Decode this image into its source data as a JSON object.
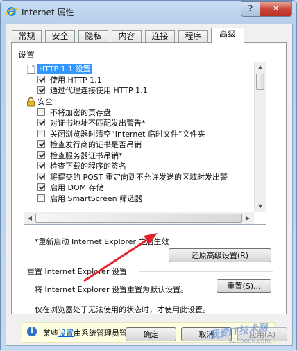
{
  "window": {
    "title": "Internet 属性",
    "help_label": "?",
    "close_label": "✕"
  },
  "tabs": [
    {
      "label": "常规",
      "active": false
    },
    {
      "label": "安全",
      "active": false
    },
    {
      "label": "隐私",
      "active": false
    },
    {
      "label": "内容",
      "active": false
    },
    {
      "label": "连接",
      "active": false
    },
    {
      "label": "程序",
      "active": false
    },
    {
      "label": "高级",
      "active": true
    }
  ],
  "settings": {
    "group_label": "设置",
    "items": [
      {
        "kind": "category",
        "icon": "page-icon",
        "text": "HTTP 1.1 设置",
        "selected": true
      },
      {
        "kind": "checkbox",
        "checked": true,
        "text": "使用 HTTP 1.1"
      },
      {
        "kind": "checkbox",
        "checked": true,
        "text": "通过代理连接使用 HTTP 1.1"
      },
      {
        "kind": "category",
        "icon": "lock-icon",
        "text": "安全",
        "selected": false
      },
      {
        "kind": "checkbox",
        "checked": false,
        "text": "不将加密的页存盘"
      },
      {
        "kind": "checkbox",
        "checked": true,
        "text": "对证书地址不匹配发出警告*"
      },
      {
        "kind": "checkbox",
        "checked": false,
        "text": "关闭浏览器时清空“Internet 临时文件”文件夹"
      },
      {
        "kind": "checkbox",
        "checked": true,
        "text": "检查发行商的证书是否吊销"
      },
      {
        "kind": "checkbox",
        "checked": true,
        "text": "检查服务器证书吊销*"
      },
      {
        "kind": "checkbox",
        "checked": true,
        "text": "检查下载的程序的签名"
      },
      {
        "kind": "checkbox",
        "checked": true,
        "text": "将提交的 POST 重定向到不允许发送的区域时发出警"
      },
      {
        "kind": "checkbox",
        "checked": true,
        "text": "启用 DOM 存储"
      },
      {
        "kind": "checkbox",
        "checked": false,
        "text": "启用 SmartScreen 筛选器"
      }
    ],
    "restart_note": "*重新启动 Internet Explorer 之后生效",
    "restore_button": "还原高级设置(R)"
  },
  "reset": {
    "title": "重置 Internet Explorer 设置",
    "description": "将 Internet Explorer 设置重置为默认设置。",
    "button": "重置(S)...",
    "note": "仅在浏览器处于无法使用的状态时，才使用此设置。"
  },
  "info": {
    "icon": "info-icon",
    "text_before": "某些",
    "link": "设置",
    "text_after": "由系统管理员管理。"
  },
  "footer": {
    "ok": "确定",
    "cancel": "取消",
    "apply": "应用(A)"
  },
  "colors": {
    "selection": "#3399ff",
    "annotation_arrow": "#e3232c",
    "info_bg": "#ffffe1"
  },
  "watermark": {
    "text": "我爱IT技术网",
    "url": "52ebook.com"
  }
}
